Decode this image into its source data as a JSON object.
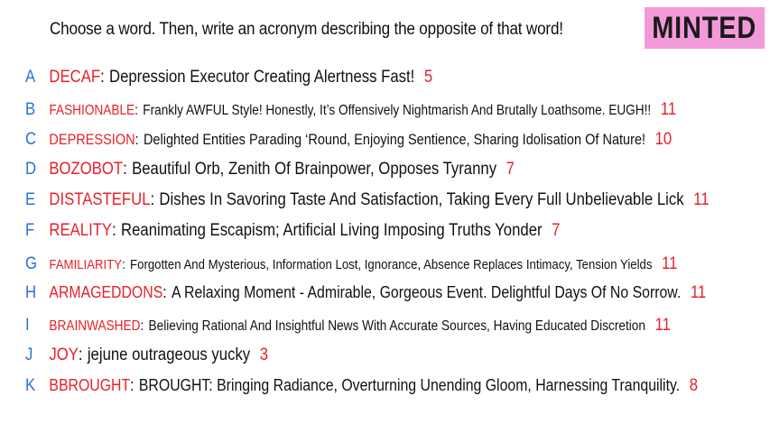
{
  "prompt": "Choose a word. Then, write an acronym describing the opposite of that word!",
  "logo": "MINTED",
  "colors": {
    "letter": "#2b6fe0",
    "word": "#e8202a",
    "count": "#e8202a",
    "logo_bg": "#f29ad9"
  },
  "answers": [
    {
      "letter": "A",
      "word": "DECAF",
      "text": "Depression Executor Creating Alertness Fast!",
      "count": "5"
    },
    {
      "letter": "B",
      "word": "FASHIONABLE",
      "text": "Frankly AWFUL Style! Honestly, It’s Offensively Nightmarish And Brutally Loathsome. EUGH!!",
      "count": "11"
    },
    {
      "letter": "C",
      "word": "DEPRESSION",
      "text": "Delighted Entities Parading ‘Round, Enjoying Sentience, Sharing Idolisation Of Nature!",
      "count": "10"
    },
    {
      "letter": "D",
      "word": "BOZOBOT",
      "text": "Beautiful Orb, Zenith Of Brainpower, Opposes Tyranny",
      "count": "7"
    },
    {
      "letter": "E",
      "word": "DISTASTEFUL",
      "text": "Dishes In Savoring Taste And Satisfaction, Taking Every Full Unbelievable Lick",
      "count": "11"
    },
    {
      "letter": "F",
      "word": "REALITY",
      "text": "Reanimating Escapism; Artificial Living Imposing Truths Yonder",
      "count": "7"
    },
    {
      "letter": "G",
      "word": "FAMILIARITY",
      "text": "Forgotten And Mysterious, Information Lost, Ignorance, Absence Replaces Intimacy, Tension Yields",
      "count": "11"
    },
    {
      "letter": "H",
      "word": "ARMAGEDDONS",
      "text": "A Relaxing Moment - Admirable, Gorgeous Event. Delightful Days Of No Sorrow.",
      "count": "11"
    },
    {
      "letter": "I",
      "word": "BRAINWASHED",
      "text": "Believing Rational And Insightful News With Accurate Sources, Having Educated Discretion",
      "count": "11"
    },
    {
      "letter": "J",
      "word": "JOY",
      "text": "jejune outrageous yucky",
      "count": "3"
    },
    {
      "letter": "K",
      "word": "BBROUGHT",
      "text": "BROUGHT: Bringing Radiance, Overturning Unending Gloom, Harnessing Tranquility.",
      "count": "8"
    }
  ]
}
